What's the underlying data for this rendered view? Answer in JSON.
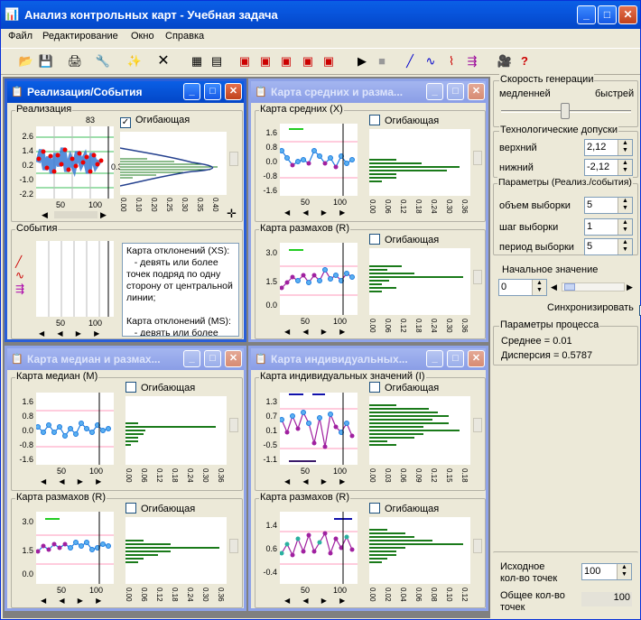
{
  "app": {
    "title": "Анализ контрольных карт - Учебная задача",
    "title_buttons": [
      "_",
      "□",
      "✕"
    ]
  },
  "menu": [
    "Файл",
    "Редактирование",
    "Окно",
    "Справка"
  ],
  "toolbar_icons": [
    "open-icon",
    "save-icon",
    "print-icon",
    "tools-icon",
    "new-window-icon",
    "delete-icon",
    "table-icon",
    "document-icon",
    "red-doc-1-icon",
    "red-doc-2-icon",
    "red-doc-3-icon",
    "red-doc-4-icon",
    "red-doc-5-icon",
    "play-icon",
    "stop-icon",
    "line-icon",
    "wave-icon",
    "step-icon",
    "mixed-icon",
    "camera-icon",
    "help-icon"
  ],
  "windows": {
    "w1": {
      "title": "Реализация/События",
      "top_group": "Реализация",
      "top_value": "83",
      "mean_value": "0.35",
      "top_y": [
        "2.6",
        "1.4",
        "0.2",
        "-1.0",
        "-2.2"
      ],
      "top_x": [
        "50",
        "100"
      ],
      "check_label": "Огибающая",
      "check_state": "✓",
      "hist_x": [
        "0.00",
        "0.05",
        "0.10",
        "0.15",
        "0.20",
        "0.25",
        "0.30",
        "0.35",
        "0.40"
      ],
      "events_group": "События",
      "events_x": [
        "50",
        "100"
      ],
      "events_text": "Карта отклонений (XS):\n   - девять или более точек подряд по одну сторону от центральной линии;\n\nКарта отклонений (MS):\n   - девять или более точек подряд по одну"
    },
    "w2": {
      "title": "Карта средних и разма...",
      "g1": "Карта средних (X)",
      "g1_y": [
        "1.6",
        "0.8",
        "0.0",
        "-0.8",
        "-1.6"
      ],
      "g1_x": [
        "50",
        "100"
      ],
      "g2": "Карта размахов (R)",
      "g2_y": [
        "3.0",
        "1.5",
        "0.0"
      ],
      "g2_x": [
        "50",
        "100"
      ],
      "check_label": "Огибающая",
      "hist_x": [
        "0.00",
        "0.06",
        "0.12",
        "0.18",
        "0.24",
        "0.30",
        "0.36"
      ]
    },
    "w3": {
      "title": "Карта медиан и размах...",
      "g1": "Карта медиан (M)",
      "g1_y": [
        "1.6",
        "0.8",
        "0.0",
        "-0.8",
        "-1.6"
      ],
      "g1_x": [
        "50",
        "100"
      ],
      "g2": "Карта размахов (R)",
      "g2_y": [
        "3.0",
        "1.5",
        "0.0"
      ],
      "g2_x": [
        "50",
        "100"
      ],
      "check_label": "Огибающая",
      "hist_x": [
        "0.00",
        "0.06",
        "0.12",
        "0.18",
        "0.24",
        "0.30",
        "0.36"
      ]
    },
    "w4": {
      "title": "Карта индивидуальных...",
      "g1": "Карта индивидуальных значений (I)",
      "g1_y": [
        "1.3",
        "0.7",
        "0.1",
        "-0.5",
        "-1.1"
      ],
      "g1_x": [
        "50",
        "100"
      ],
      "g2": "Карта размахов (R)",
      "g2_y": [
        "1.4",
        "0.6",
        "-0.4"
      ],
      "g2_x": [
        "50",
        "100"
      ],
      "check_label": "Огибающая",
      "hist_x1": [
        "0.00",
        "0.03",
        "0.06",
        "0.09",
        "0.12",
        "0.15",
        "0.18"
      ],
      "hist_x2": [
        "0.00",
        "0.02",
        "0.04",
        "0.06",
        "0.08",
        "0.10",
        "0.12"
      ]
    }
  },
  "right": {
    "speed": {
      "label": "Скорость генерации",
      "slow": "медленней",
      "fast": "быстрей"
    },
    "tol": {
      "label": "Технологические допуски",
      "upper_label": "верхний",
      "upper": "2,12",
      "lower_label": "нижний",
      "lower": "-2,12"
    },
    "params": {
      "label": "Параметры (Реализ./события)",
      "n_label": "объем выборки",
      "n": "5",
      "step_label": "шаг выборки",
      "step": "1",
      "period_label": "период выборки",
      "period": "5"
    },
    "init": {
      "label": "Начальное значение",
      "value": "0",
      "sync": "Синхронизировать",
      "sync_state": "✓"
    },
    "proc": {
      "label": "Параметры процесса",
      "mean": "Среднее = 0.01",
      "disp": "Дисперсия = 0.5787"
    },
    "count": {
      "label1": "Исходное",
      "label2": "кол-во точек",
      "value": "100",
      "total1": "Общее кол-во",
      "total2": "точек",
      "total": "100"
    }
  }
}
